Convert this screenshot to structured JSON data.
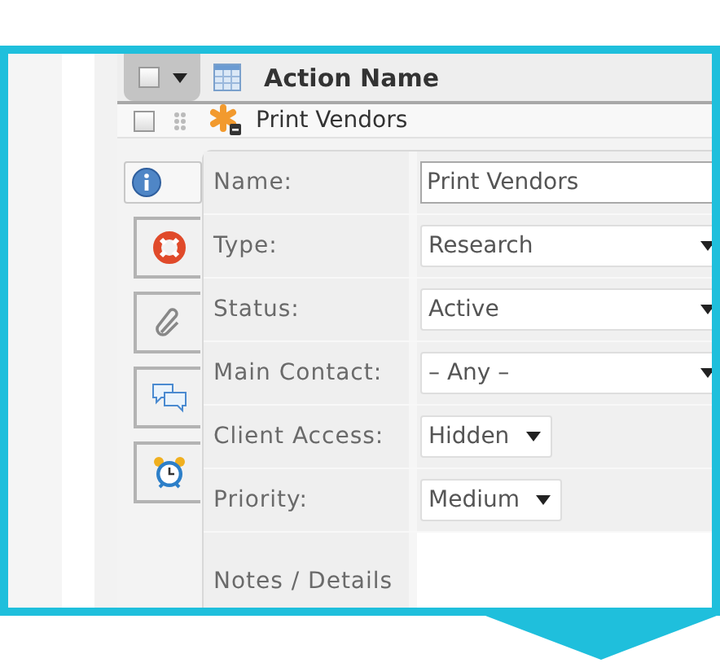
{
  "header": {
    "title": "Action Name",
    "checked": false
  },
  "record": {
    "name": "Print Vendors",
    "checked": false
  },
  "side_tabs": [
    {
      "selected": true
    },
    {
      "selected": false
    },
    {
      "selected": false
    },
    {
      "selected": false
    },
    {
      "selected": false
    }
  ],
  "fields": [
    {
      "kind": "text",
      "label": "Name:",
      "value": "Print Vendors"
    },
    {
      "kind": "wideselect",
      "label": "Type:",
      "value": "Research"
    },
    {
      "kind": "wideselect",
      "label": "Status:",
      "value": "Active"
    },
    {
      "kind": "wideselect",
      "label": "Main Contact:",
      "value": "– Any –"
    },
    {
      "kind": "select",
      "label": "Client Access:",
      "value": "Hidden"
    },
    {
      "kind": "select",
      "label": "Priority:",
      "value": "Medium"
    },
    {
      "kind": "textarea",
      "label": "Notes / Details"
    }
  ]
}
